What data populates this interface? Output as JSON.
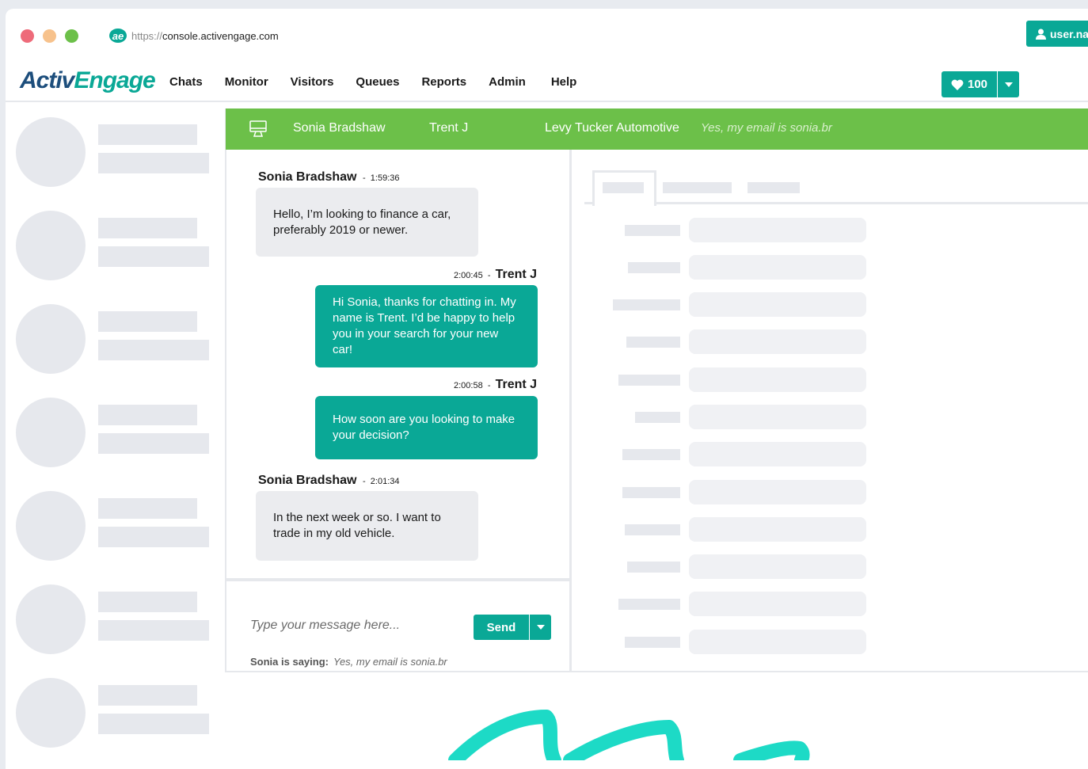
{
  "browser": {
    "url_protocol": "https://",
    "url_host": "console.activengage.com",
    "favicon_text": "ae"
  },
  "nav": {
    "brand_part1": "Activ",
    "brand_part2": "Engage",
    "links": [
      "Chats",
      "Monitor",
      "Visitors",
      "Queues",
      "Reports",
      "Admin",
      "Help"
    ],
    "hearts_count": "100",
    "user_label": "user.na"
  },
  "chat_header": {
    "visitor": "Sonia Bradshaw",
    "agent": "Trent J",
    "dealer": "Levy Tucker Automotive",
    "preview": "Yes, my email is sonia.br"
  },
  "messages": [
    {
      "sender": "Sonia Bradshaw",
      "time": "1:59:36",
      "text": "Hello, I’m looking to finance a car, preferably 2019 or newer.",
      "direction": "in"
    },
    {
      "sender": "Trent J",
      "time": "2:00:45",
      "text": "Hi Sonia, thanks for chatting in. My name is Trent. I’d be happy to help you in your search for your new car!",
      "direction": "out"
    },
    {
      "sender": "Trent J",
      "time": "2:00:58",
      "text": "How soon are you looking to make your decision?",
      "direction": "out"
    },
    {
      "sender": "Sonia Bradshaw",
      "time": "2:01:34",
      "text": "In the next week or so. I want to trade in my old vehicle.",
      "direction": "in"
    }
  ],
  "compose": {
    "placeholder": "Type your message here...",
    "send_label": "Send",
    "typing_label": "Sonia is saying:",
    "typing_text": "Yes, my email is sonia.br"
  },
  "colors": {
    "accent": "#0aa896",
    "header_green": "#6cc049",
    "brand_navy": "#1d4e7c",
    "skeleton": "#e6e8ed"
  }
}
